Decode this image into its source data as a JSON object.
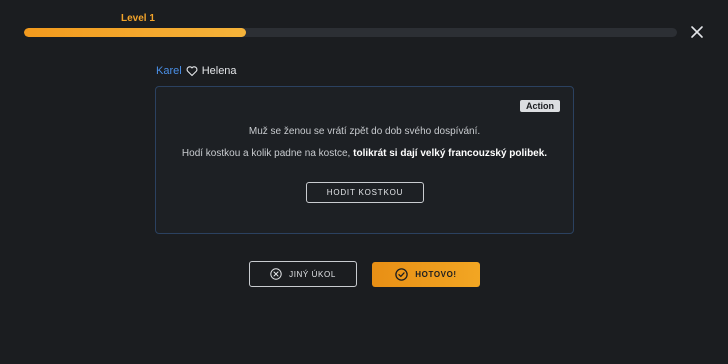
{
  "header": {
    "level_label": "Level 1",
    "progress": 0.34,
    "close_icon": "close-icon"
  },
  "players": {
    "player_a": "Karel",
    "relation_icon": "heart-icon",
    "player_b": "Helena"
  },
  "task": {
    "badge": "Action",
    "line1": "Muž se ženou se vrátí zpět do dob svého dospívání.",
    "line2_plain": "Hodí kostkou a kolik padne na kostce, ",
    "line2_bold": "tolikrát si dají velký francouzský polibek.",
    "roll_button": "HODIT KOSTKOU"
  },
  "actions": {
    "other_task_label": "JINÝ ÚKOL",
    "other_task_icon": "x-circle-icon",
    "done_label": "HOTOVO!",
    "done_icon": "check-circle-icon"
  },
  "colors": {
    "accent": "#f3a42a",
    "background": "#1b1d20",
    "player_a": "#4a8fe6",
    "card_border": "#2b4160"
  }
}
